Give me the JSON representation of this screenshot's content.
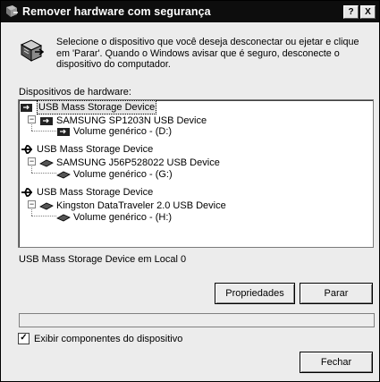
{
  "window": {
    "title": "Remover hardware com segurança",
    "help_btn": "?",
    "close_btn": "X"
  },
  "description": "Selecione o dispositivo que você deseja desconectar ou ejetar e clique em 'Parar'. Quando o Windows avisar que é seguro, desconecte o dispositivo do computador.",
  "devices_label": "Dispositivos de hardware:",
  "tree": {
    "items": [
      {
        "label": "USB Mass Storage Device",
        "level": 0,
        "icon": "usb-drive-icon",
        "selected": true
      },
      {
        "label": "SAMSUNG SP1203N USB Device",
        "level": 1,
        "icon": "disk-drive-icon"
      },
      {
        "label": "Volume genérico - (D:)",
        "level": 2,
        "icon": "disk-drive-icon"
      },
      {
        "label": "USB Mass Storage Device",
        "level": 0,
        "icon": "usb-icon"
      },
      {
        "label": "SAMSUNG J56P528022 USB Device",
        "level": 1,
        "icon": "removable-drive-icon"
      },
      {
        "label": "Volume genérico - (G:)",
        "level": 2,
        "icon": "removable-drive-icon"
      },
      {
        "label": "USB Mass Storage Device",
        "level": 0,
        "icon": "usb-icon"
      },
      {
        "label": "Kingston DataTraveler 2.0 USB Device",
        "level": 1,
        "icon": "removable-drive-icon"
      },
      {
        "label": "Volume genérico - (H:)",
        "level": 2,
        "icon": "removable-drive-icon"
      }
    ]
  },
  "status_text": "USB Mass Storage Device em Local 0",
  "buttons": {
    "properties": "Propriedades",
    "stop": "Parar",
    "close": "Fechar"
  },
  "checkbox": {
    "label": "Exibir componentes do dispositivo",
    "checked": true,
    "mark": "✓"
  }
}
